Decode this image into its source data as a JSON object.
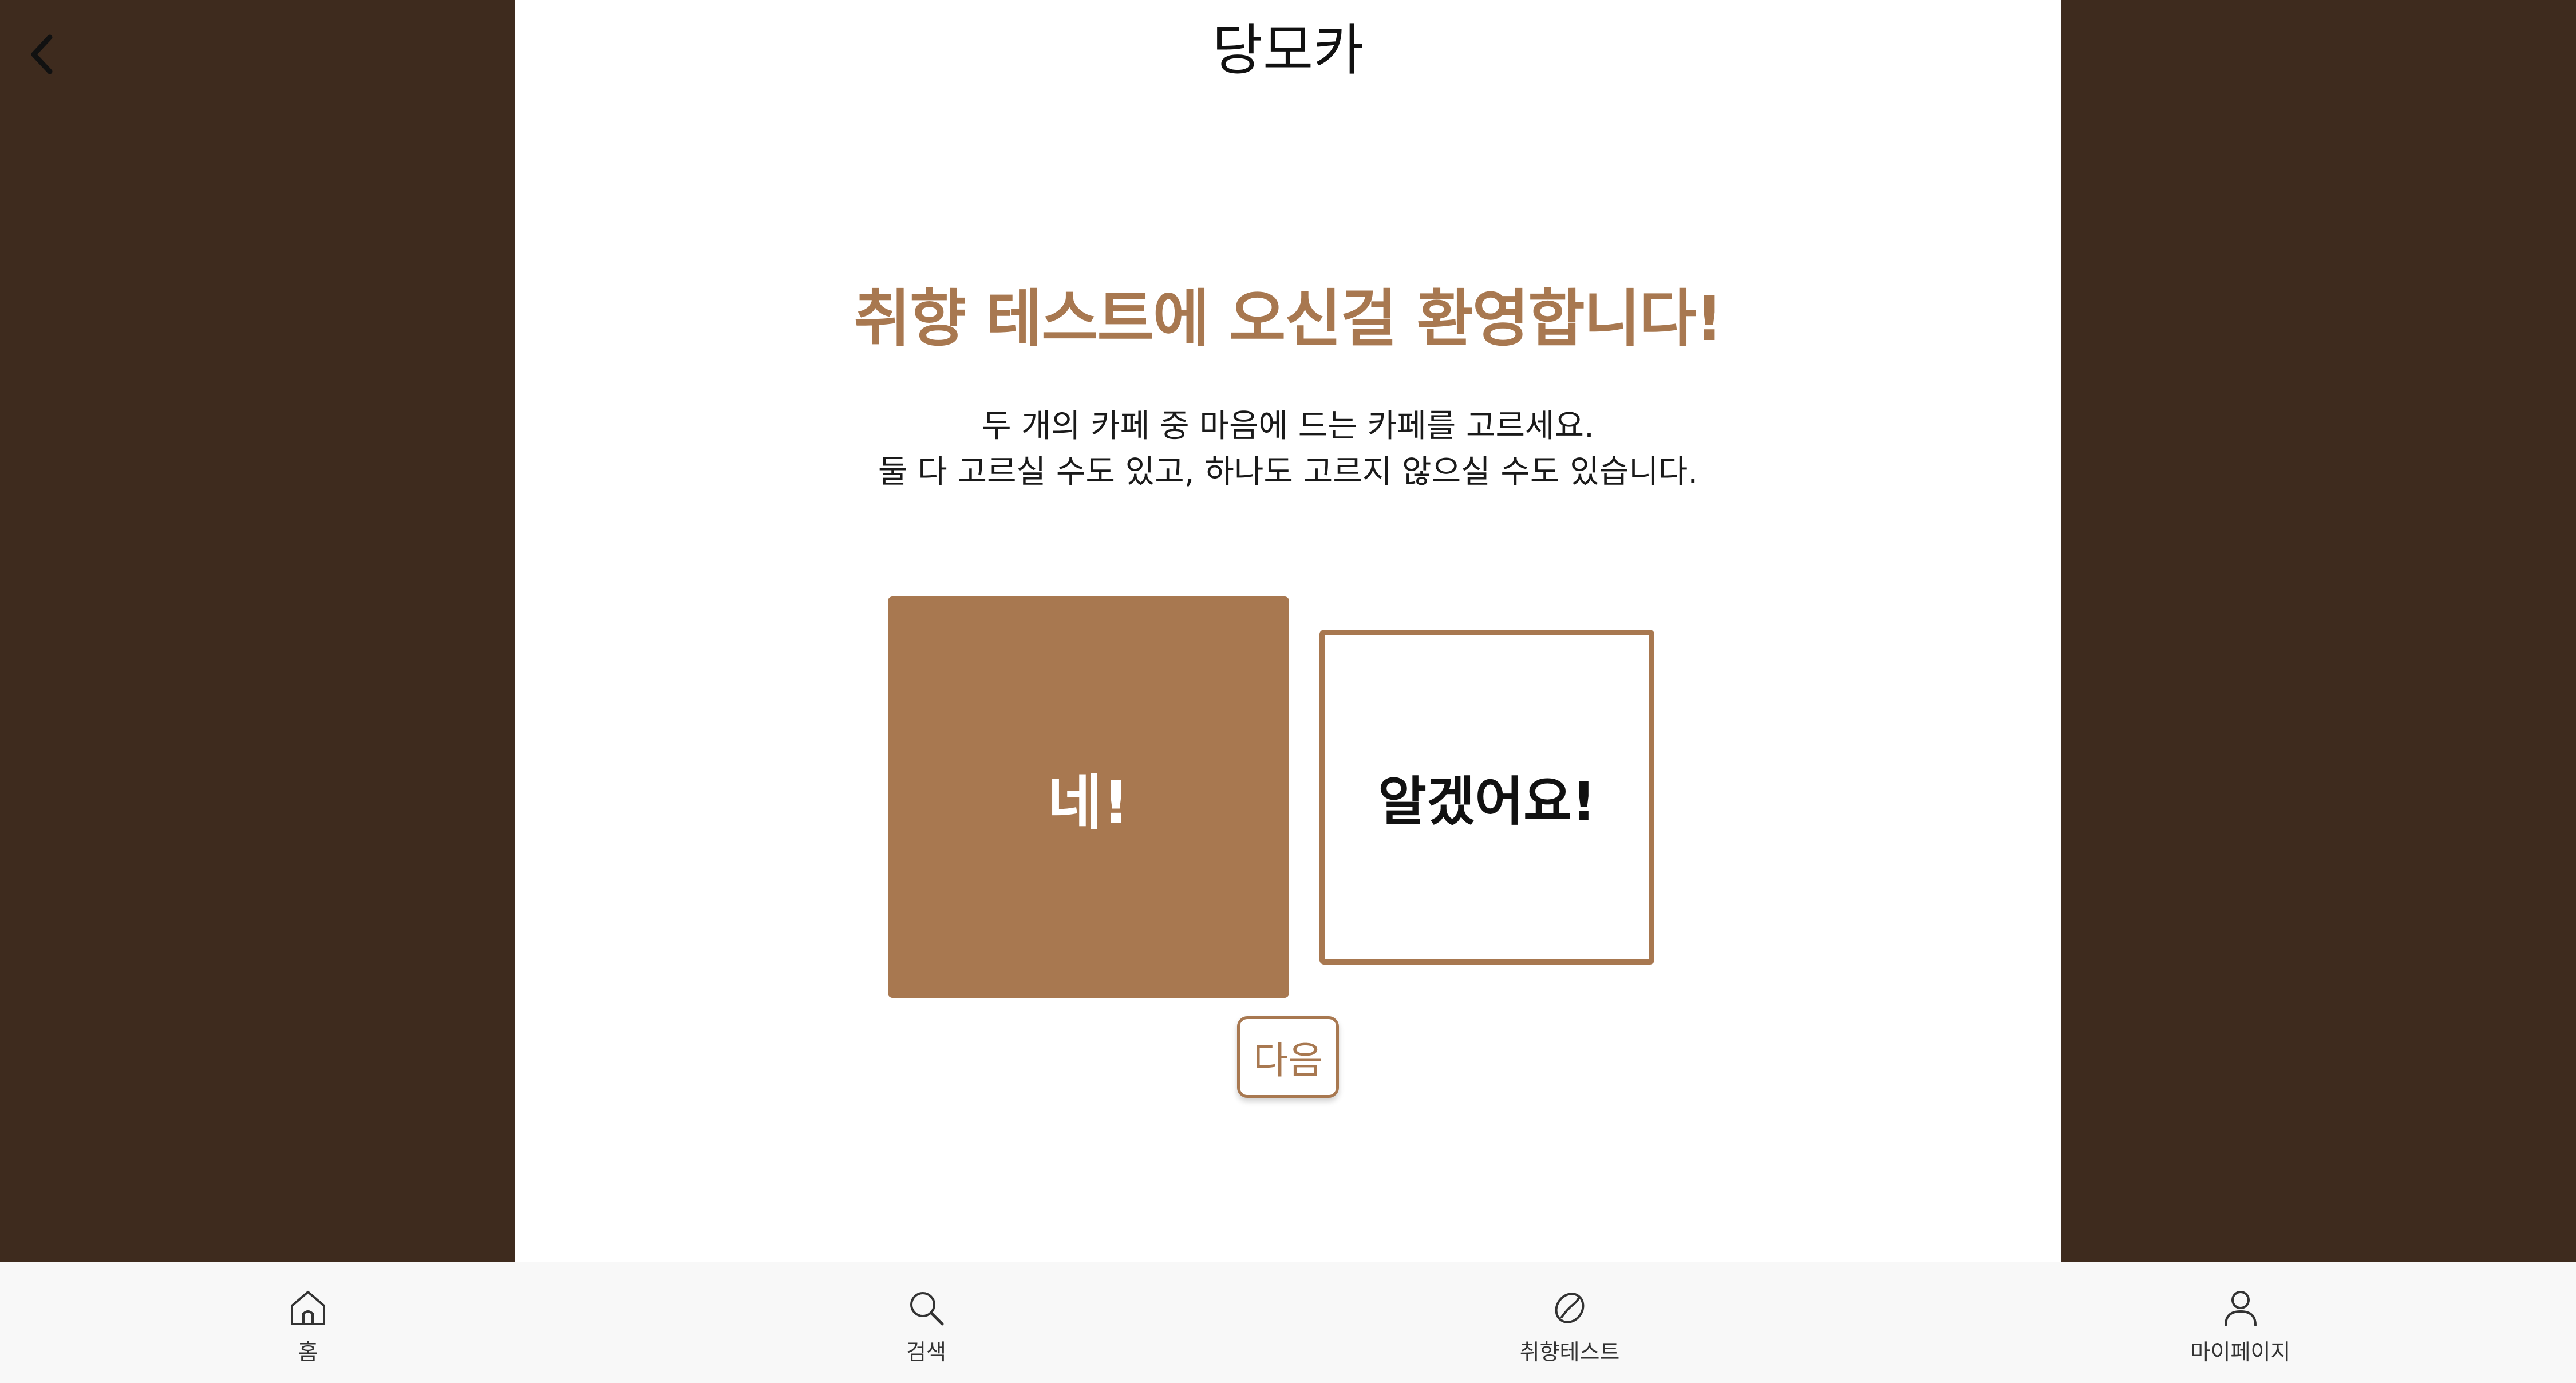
{
  "app_title": "당모카",
  "headline": "취향 테스트에 오신걸 환영합니다!",
  "description": {
    "line1": "두 개의 카페 중 마음에 드는 카페를 고르세요.",
    "line2": "둘 다 고르실 수도 있고, 하나도 고르지 않으실 수도 있습니다."
  },
  "choices": {
    "yes_label": "네!",
    "ok_label": "알겠어요!"
  },
  "next_label": "다음",
  "nav": {
    "items": [
      {
        "label": "홈",
        "icon": "home-icon"
      },
      {
        "label": "검색",
        "icon": "search-icon"
      },
      {
        "label": "취향테스트",
        "icon": "coffee-bean-icon"
      },
      {
        "label": "마이페이지",
        "icon": "user-icon"
      }
    ]
  },
  "colors": {
    "background": "#3e2b1e",
    "accent": "#a87850",
    "panel": "#ffffff",
    "nav_background": "#f8f8f8"
  }
}
